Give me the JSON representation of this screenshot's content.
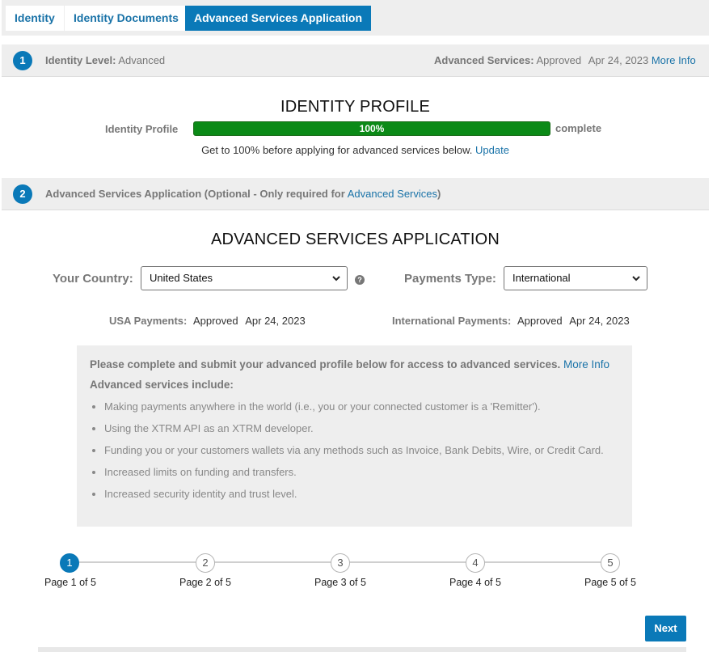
{
  "tabs": [
    {
      "label": "Identity"
    },
    {
      "label": "Identity Documents"
    },
    {
      "label": "Advanced Services Application"
    }
  ],
  "step1": {
    "number": "1",
    "identity_level_label": "Identity Level:",
    "identity_level_value": "Advanced",
    "adv_services_label": "Advanced Services:",
    "adv_services_status": "Approved",
    "adv_services_date": "Apr 24, 2023",
    "more_info": "More Info"
  },
  "profile": {
    "title": "IDENTITY PROFILE",
    "progress_label": "Identity Profile",
    "progress_value": "100%",
    "progress_fraction": 1.0,
    "progress_suffix": "complete",
    "note": "Get to 100% before applying for advanced services below.",
    "update_link": "Update"
  },
  "step2": {
    "number": "2",
    "label": "Advanced Services Application (Optional - Only required for",
    "link": "Advanced Services",
    "close": ")"
  },
  "application": {
    "title": "ADVANCED SERVICES APPLICATION",
    "country_label": "Your Country:",
    "country_value": "United States",
    "help_icon": "?",
    "payments_type_label": "Payments Type:",
    "payments_type_value": "International",
    "usa_payments_label": "USA Payments:",
    "usa_payments_status": "Approved",
    "usa_payments_date": "Apr 24, 2023",
    "intl_payments_label": "International Payments:",
    "intl_payments_status": "Approved",
    "intl_payments_date": "Apr 24, 2023"
  },
  "info": {
    "lead": "Please complete and submit your advanced profile below for access to advanced services.",
    "more_info": "More Info",
    "sub": "Advanced services include:",
    "items": [
      "Making payments anywhere in the world (i.e., you or your connected customer is a 'Remitter').",
      "Using the XTRM API as an XTRM developer.",
      "Funding you or your customers wallets via any methods such as Invoice, Bank Debits, Wire, or Credit Card.",
      "Increased limits on funding and transfers.",
      "Increased security identity and trust level."
    ]
  },
  "wizard": {
    "steps": [
      {
        "num": "1",
        "label": "Page 1 of 5"
      },
      {
        "num": "2",
        "label": "Page 2 of 5"
      },
      {
        "num": "3",
        "label": "Page 3 of 5"
      },
      {
        "num": "4",
        "label": "Page 4 of 5"
      },
      {
        "num": "5",
        "label": "Page 5 of 5"
      }
    ],
    "next_label": "Next"
  },
  "colors": {
    "accent": "#0a79b8",
    "progress": "#0b8a17",
    "band": "#eeeeee"
  }
}
